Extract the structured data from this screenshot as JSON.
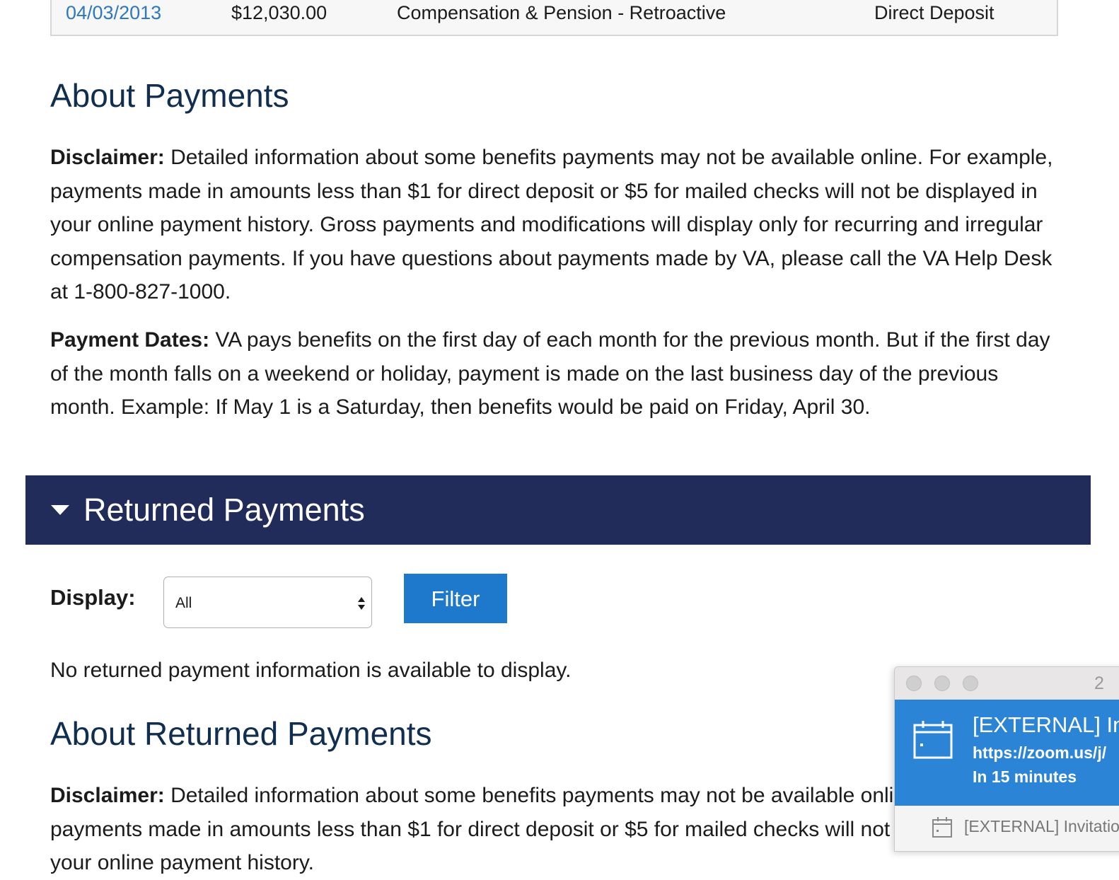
{
  "payments_table": {
    "row": {
      "date": "04/03/2013",
      "amount": "$12,030.00",
      "type": "Compensation & Pension - Retroactive",
      "method": "Direct Deposit"
    }
  },
  "about_payments": {
    "heading": "About Payments",
    "disclaimer_label": "Disclaimer:",
    "disclaimer_text": " Detailed information about some benefits payments may not be available online. For example, payments made in amounts less than $1 for direct deposit or $5 for mailed checks will not be displayed in your online payment history. Gross payments and modifications will display only for recurring and irregular compensation payments. If you have questions about payments made by VA, please call the VA Help Desk at 1-800-827-1000.",
    "dates_label": "Payment Dates:",
    "dates_text": " VA pays benefits on the first day of each month for the previous month. But if the first day of the month falls on a weekend or holiday, payment is made on the last business day of the previous month. Example: If May 1 is a Saturday, then benefits would be paid on Friday, April 30."
  },
  "returned_payments": {
    "accordion_title": "Returned Payments",
    "display_label": "Display:",
    "select_value": "All",
    "filter_label": "Filter",
    "empty_message": "No returned payment information is available to display."
  },
  "about_returned": {
    "heading": "About Returned Payments",
    "disclaimer_label": "Disclaimer:",
    "disclaimer_text": " Detailed information about some benefits payments may not be available online. For example, payments made in amounts less than $1 for direct deposit or $5 for mailed checks will not be displayed in your online payment history."
  },
  "notification": {
    "count": "2",
    "event_title": "[EXTERNAL] Invitation",
    "event_url": "https://zoom.us/j/",
    "event_time": "In 15 minutes",
    "second_item": "[EXTERNAL] Invitation",
    "icon": "calendar-icon"
  },
  "colors": {
    "accordion_bg": "#212c5a",
    "filter_button": "#1e78cc",
    "heading": "#112e51",
    "link": "#2e78be",
    "notification_blue": "#2b84d6"
  }
}
